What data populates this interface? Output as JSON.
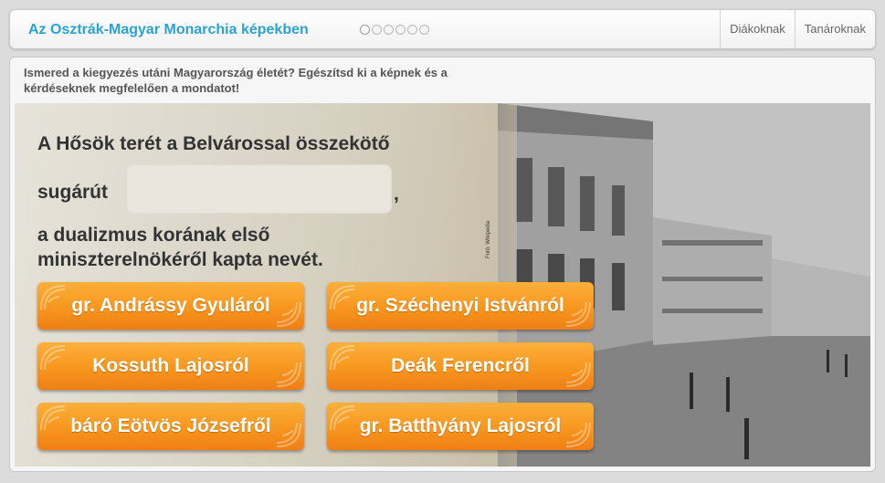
{
  "header": {
    "title": "Az Osztrák-Magyar Monarchia képekben",
    "progress": {
      "total": 6,
      "current": 1
    },
    "nav": [
      {
        "label": "Diákoknak"
      },
      {
        "label": "Tanároknak"
      }
    ]
  },
  "instructions": "Ismered a kiegyezés utáni Magyarország életét? Egészítsd ki a képnek és a kérdéseknek megfelelően a mondatot!",
  "question": {
    "line1": "A Hősök terét a Belvárossal összekötő",
    "line2_prefix": "sugárút",
    "answer": "",
    "line2_suffix": ",",
    "line3": "a dualizmus korának első",
    "line4": "miniszterelnökéről kapta nevét."
  },
  "photo": {
    "credit": "Fotó: Wikipedia"
  },
  "options": [
    {
      "label": "gr. Andrássy Gyuláról"
    },
    {
      "label": "gr. Széchenyi Istvánról"
    },
    {
      "label": "Kossuth Lajosról"
    },
    {
      "label": "Deák Ferencről"
    },
    {
      "label": "báró Eötvös Józsefről"
    },
    {
      "label": "gr. Batthyány Lajosról"
    }
  ],
  "colors": {
    "title": "#29a3d4",
    "option_top": "#fbb03b",
    "option_bottom": "#ef7f16",
    "question_text": "#333333"
  }
}
